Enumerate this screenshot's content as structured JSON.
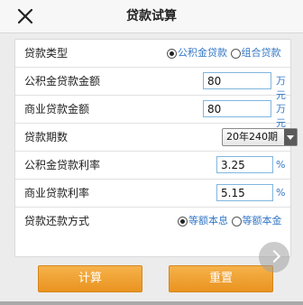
{
  "header": {
    "title": "贷款试算",
    "close_icon": "close-icon"
  },
  "form": {
    "loan_type": {
      "label": "贷款类型",
      "options": [
        "公积金贷款",
        "组合贷款"
      ],
      "selected": "公积金贷款"
    },
    "provident_amount": {
      "label": "公积金贷款金额",
      "value": "80",
      "unit": "万元"
    },
    "commercial_amount": {
      "label": "商业贷款金额",
      "value": "80",
      "unit": "万元"
    },
    "loan_term": {
      "label": "贷款期数",
      "selected": "20年240期"
    },
    "provident_rate": {
      "label": "公积金贷款利率",
      "value": "3.25",
      "unit": "%"
    },
    "commercial_rate": {
      "label": "商业贷款利率",
      "value": "5.15",
      "unit": "%"
    },
    "repayment_method": {
      "label": "贷款还款方式",
      "options": [
        "等额本息",
        "等额本金"
      ],
      "selected": "等额本息"
    }
  },
  "buttons": {
    "calculate": "计算",
    "reset": "重置"
  },
  "colors": {
    "accent_button": "#ea9320",
    "link_blue": "#3478c6",
    "input_border": "#7fb6df"
  }
}
